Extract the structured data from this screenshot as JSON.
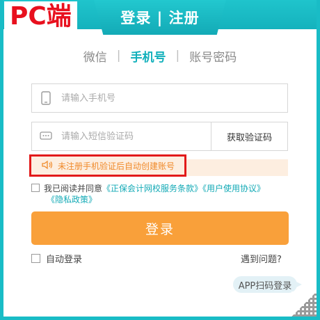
{
  "overlay_label": "PC端",
  "header": {
    "title": "登录 | 注册"
  },
  "tabs": [
    {
      "label": "微信",
      "active": false
    },
    {
      "label": "手机号",
      "active": true
    },
    {
      "label": "账号密码",
      "active": false
    }
  ],
  "phone": {
    "placeholder": "请输入手机号",
    "icon": "phone-icon"
  },
  "sms": {
    "placeholder": "请输入短信验证码",
    "icon": "message-icon",
    "button_label": "获取验证码"
  },
  "notice": {
    "text": "未注册手机验证后自动创建账号",
    "icon": "speaker-icon"
  },
  "agreement": {
    "prefix": "我已阅读并同意",
    "link1": "《正保会计网校服务条款》",
    "link2": "《用户使用协议》",
    "link3": "《隐私政策》"
  },
  "login_button": "登录",
  "auto_login": "自动登录",
  "help": "遇到问题?",
  "app_scan": "APP扫码登录",
  "colors": {
    "brand": "#19bcc6",
    "accent": "#f9a03a",
    "highlight": "#e21a1a"
  }
}
